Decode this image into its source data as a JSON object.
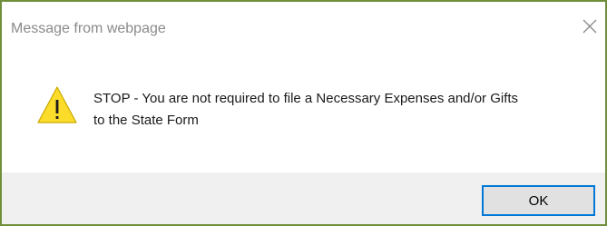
{
  "dialog": {
    "title": "Message from webpage",
    "icon": "warning-icon",
    "message_line1": "STOP - You are not required to file a Necessary Expenses and/or Gifts",
    "message_line2": "to the State Form",
    "ok_label": "OK",
    "close_icon": "close-icon"
  },
  "colors": {
    "window_border": "#6f8f3a",
    "footer_bg": "#f0f0f0",
    "button_border": "#0078d7",
    "warning_fill": "#fcdc2a"
  }
}
